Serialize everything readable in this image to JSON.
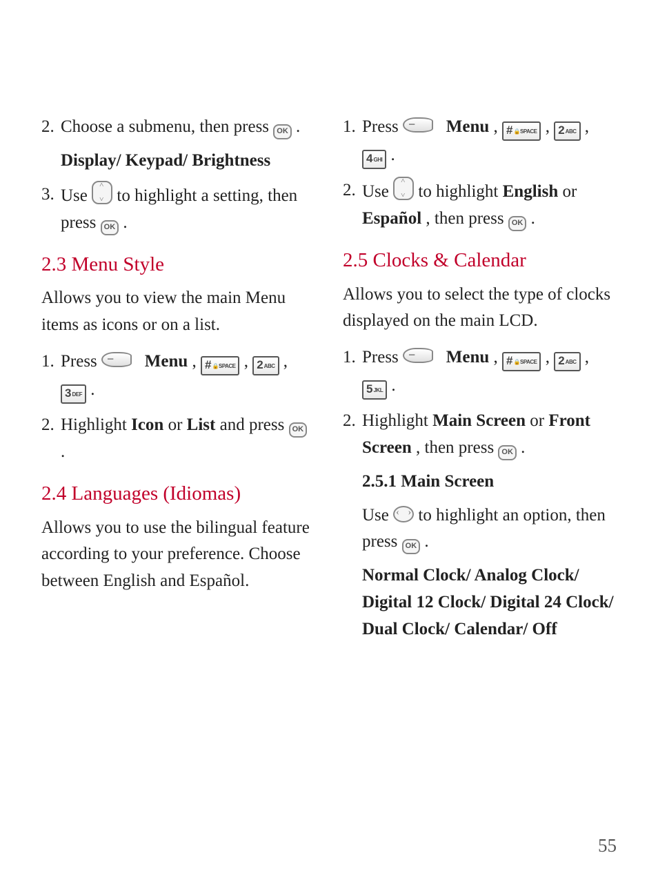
{
  "page_number": "55",
  "left": {
    "step2_prefix": "2.",
    "step2_a": "Choose a submenu, then press ",
    "step2_b": " .",
    "sub_list": "Display/ Keypad/ Brightness",
    "step3_prefix": "3.",
    "step3_a": "Use ",
    "step3_b": " to highlight a setting, then press ",
    "step3_c": " .",
    "h23": "2.3 Menu Style",
    "p23": "Allows you to view the main Menu items as icons or on a list.",
    "s23_1_prefix": "1.",
    "s23_1_a": "Press ",
    "s23_1_menu": "Menu",
    "s23_1_c": " , ",
    "s23_1_d": " , ",
    "s23_1_e": " , ",
    "s23_1_f": " .",
    "s23_2_prefix": "2.",
    "s23_2_a": "Highlight ",
    "s23_2_b": "Icon",
    "s23_2_c": " or ",
    "s23_2_d": "List",
    "s23_2_e": " and press ",
    "s23_2_f": " .",
    "h24": "2.4 Languages (Idiomas)",
    "p24": "Allows you to use the bilingual feature according to your preference. Choose between English and Español."
  },
  "right": {
    "s24_1_prefix": "1.",
    "s24_1_a": "Press ",
    "s24_1_menu": "Menu",
    "s24_1_c": " , ",
    "s24_1_d": " , ",
    "s24_1_e": " , ",
    "s24_1_f": " .",
    "s24_2_prefix": "2.",
    "s24_2_a": "Use ",
    "s24_2_b": " to highlight ",
    "s24_2_c": "English",
    "s24_2_d": " or ",
    "s24_2_e": "Español",
    "s24_2_f": ", then press ",
    "s24_2_g": " .",
    "h25": "2.5 Clocks & Calendar",
    "p25": "Allows you to select the type of clocks displayed on the main LCD.",
    "s25_1_prefix": "1.",
    "s25_1_a": "Press ",
    "s25_1_menu": "Menu",
    "s25_1_c": " , ",
    "s25_1_d": " , ",
    "s25_1_e": " , ",
    "s25_1_f": " .",
    "s25_2_prefix": "2.",
    "s25_2_a": "Highlight ",
    "s25_2_b": "Main Screen",
    "s25_2_c": " or ",
    "s25_2_d": "Front Screen",
    "s25_2_e": ", then press ",
    "s25_2_f": "  .",
    "h251": "2.5.1 Main Screen",
    "s251_a": "Use ",
    "s251_b": " to highlight an option, then press ",
    "s251_c": " .",
    "clock_list": "Normal Clock/ Analog Clock/ Digital 12 Clock/ Digital 24 Clock/ Dual Clock/ Calendar/ Off"
  },
  "keys": {
    "hash_big": "#",
    "hash_small": "SPACE",
    "two_big": "2",
    "two_small": "ABC",
    "three_big": "3",
    "three_small": "DEF",
    "four_big": "4",
    "four_small": "GHI",
    "five_big": "5",
    "five_small": "JKL",
    "ok": "OK"
  }
}
